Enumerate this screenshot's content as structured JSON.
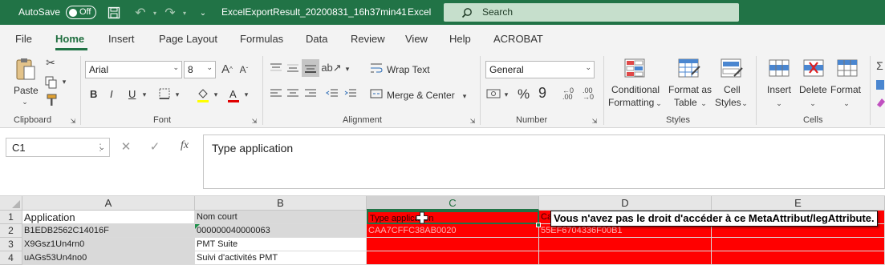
{
  "titlebar": {
    "autosave_label": "AutoSave",
    "autosave_state": "Off",
    "filename": "ExcelExportResult_20200831_16h37min41",
    "separator": "-",
    "app_name": "Excel",
    "search_placeholder": "Search"
  },
  "tabs": [
    "File",
    "Home",
    "Insert",
    "Page Layout",
    "Formulas",
    "Data",
    "Review",
    "View",
    "Help",
    "ACROBAT"
  ],
  "active_tab": "Home",
  "ribbon": {
    "clipboard": {
      "paste": "Paste",
      "label": "Clipboard"
    },
    "font": {
      "name": "Arial",
      "size": "8",
      "label": "Font",
      "bold": "B",
      "italic": "I",
      "underline": "U"
    },
    "alignment": {
      "wrap_text": "Wrap Text",
      "merge_center": "Merge & Center",
      "label": "Alignment"
    },
    "number": {
      "format": "General",
      "label": "Number",
      "percent": "%",
      "comma": "9"
    },
    "styles": {
      "conditional_1": "Conditional",
      "conditional_2": "Formatting",
      "format_as_1": "Format as",
      "format_as_2": "Table",
      "cell_1": "Cell",
      "cell_2": "Styles",
      "label": "Styles"
    },
    "cells": {
      "insert": "Insert",
      "delete": "Delete",
      "format": "Format",
      "label": "Cells"
    }
  },
  "formula_bar": {
    "name_box": "C1",
    "fx": "fx",
    "content": "Type application"
  },
  "grid": {
    "columns": [
      "A",
      "B",
      "C",
      "D",
      "E"
    ],
    "selected_column": "C",
    "rows": [
      {
        "num": "1",
        "a": "Application",
        "b": "Nom court",
        "c": "Type application",
        "d": "Ca",
        "e": ""
      },
      {
        "num": "2",
        "a": "B1EDB2562C14016F",
        "b": "000000040000063",
        "c": "CAA7CFFC38AB0020",
        "d": "55EF6704336F00B1",
        "e": ""
      },
      {
        "num": "3",
        "a": "X9Gsz1Un4rn0",
        "b": "PMT Suite",
        "c": "",
        "d": "",
        "e": ""
      },
      {
        "num": "4",
        "a": "uAGs53Un4no0",
        "b": "Suivi d'activités PMT",
        "c": "",
        "d": "",
        "e": ""
      }
    ],
    "tooltip": "Vous n'avez pas le droit d'accéder à ce MetaAttribut/legAttribute."
  }
}
